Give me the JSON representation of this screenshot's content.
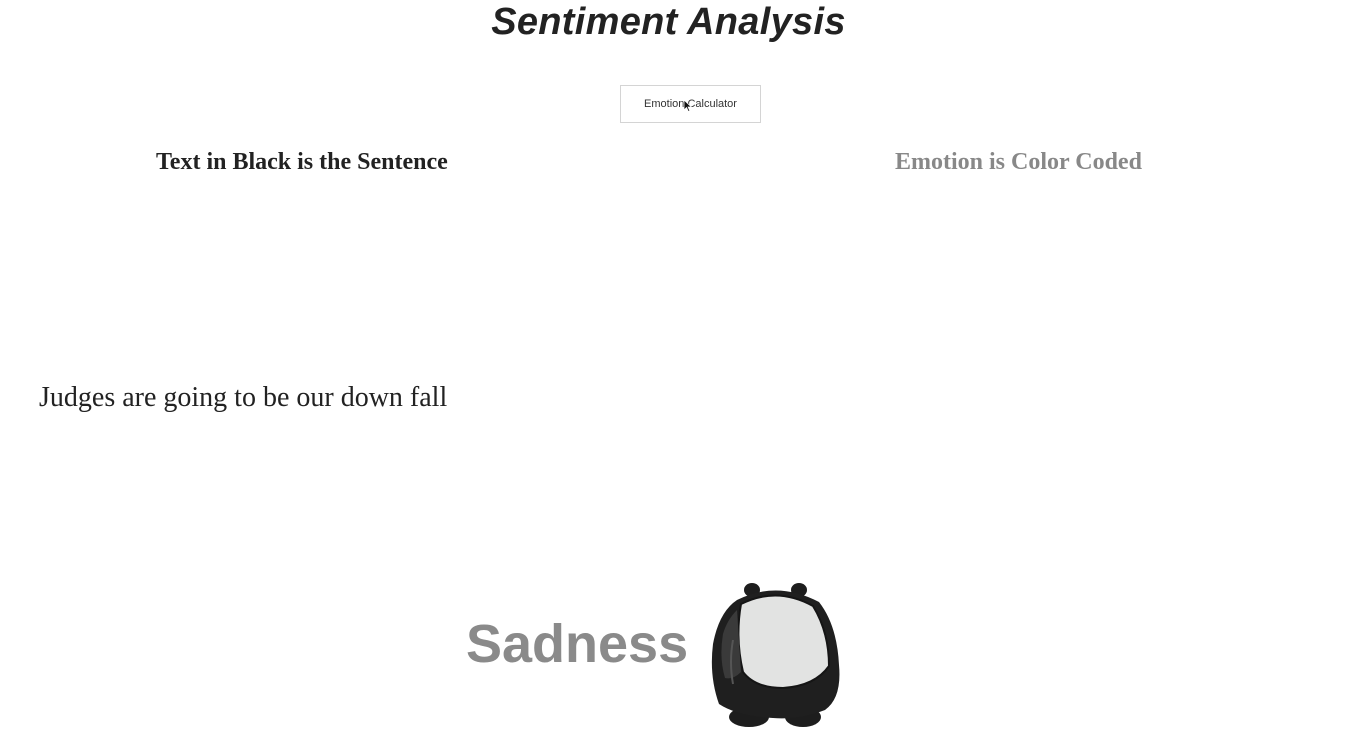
{
  "header": {
    "title": "Sentiment Analysis"
  },
  "toolbar": {
    "calculator_button_label": "Emotion Calculator"
  },
  "columns": {
    "left_heading": "Text in Black is the Sentence",
    "right_heading": "Emotion is Color Coded"
  },
  "result": {
    "sentence": "Judges are going to be our down fall",
    "emotion": "Sadness",
    "emotion_color": "#8a8a8a",
    "illustration": "sad-panda-icon"
  },
  "colors": {
    "text_primary": "#222222",
    "text_muted": "#888888",
    "button_border": "#d4d4d4"
  }
}
